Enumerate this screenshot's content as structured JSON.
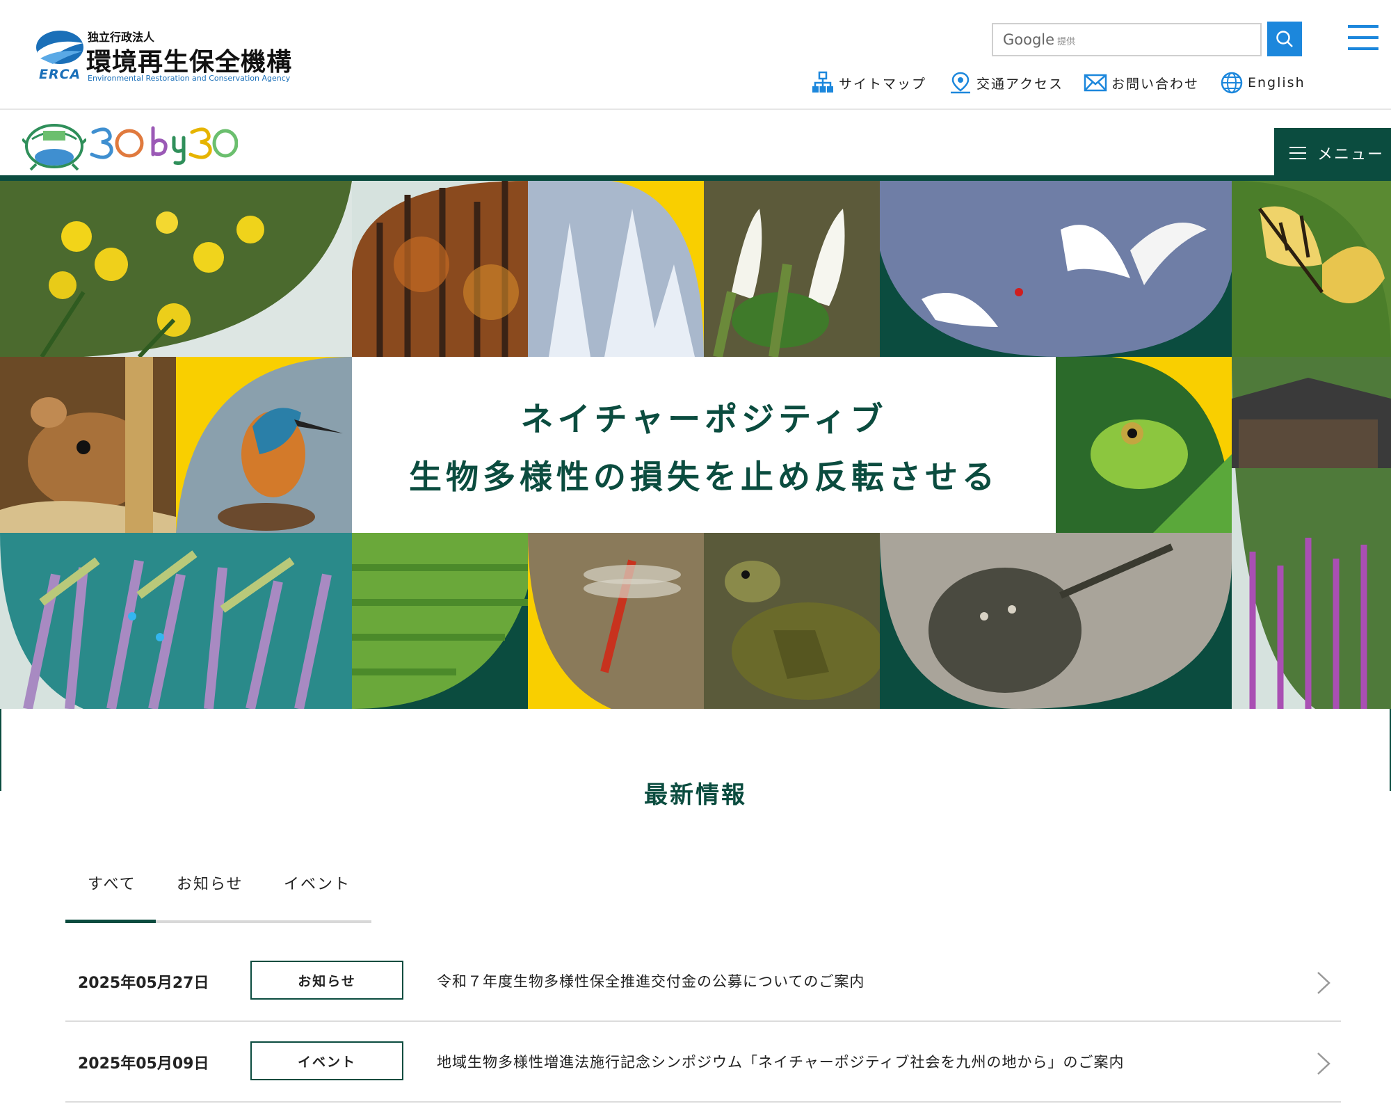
{
  "header": {
    "logo": {
      "subtitle": "独立行政法人",
      "name": "環境再生保全機構",
      "abbr": "ERCA",
      "english": "Environmental Restoration and Conservation Agency"
    },
    "search": {
      "placeholder": "Google",
      "provider": "提供"
    },
    "links": [
      {
        "label": "サイトマップ",
        "icon": "sitemap-icon"
      },
      {
        "label": "交通アクセス",
        "icon": "map-pin-icon"
      },
      {
        "label": "お問い合わせ",
        "icon": "mail-icon"
      },
      {
        "label": "English",
        "icon": "globe-icon"
      }
    ]
  },
  "subheader": {
    "logo_text": "30by30",
    "menu_label": "メニュー"
  },
  "hero": {
    "line1": "ネイチャーポジティブ",
    "line2": "生物多様性の損失を止め反転させる"
  },
  "news": {
    "title": "最新情報",
    "tabs": [
      "すべて",
      "お知らせ",
      "イベント"
    ],
    "active_tab": 0,
    "items": [
      {
        "date": "2025年05月27日",
        "category": "お知らせ",
        "title": "令和７年度生物多様性保全推進交付金の公募についてのご案内"
      },
      {
        "date": "2025年05月09日",
        "category": "イベント",
        "title": "地域生物多様性増進法施行記念シンポジウム「ネイチャーポジティブ社会を九州の地から」のご案内"
      }
    ]
  },
  "colors": {
    "brand_green": "#0b4c3f",
    "accent_blue": "#1c87dc",
    "yellow": "#f9cf00",
    "pale": "#d6e2de"
  }
}
